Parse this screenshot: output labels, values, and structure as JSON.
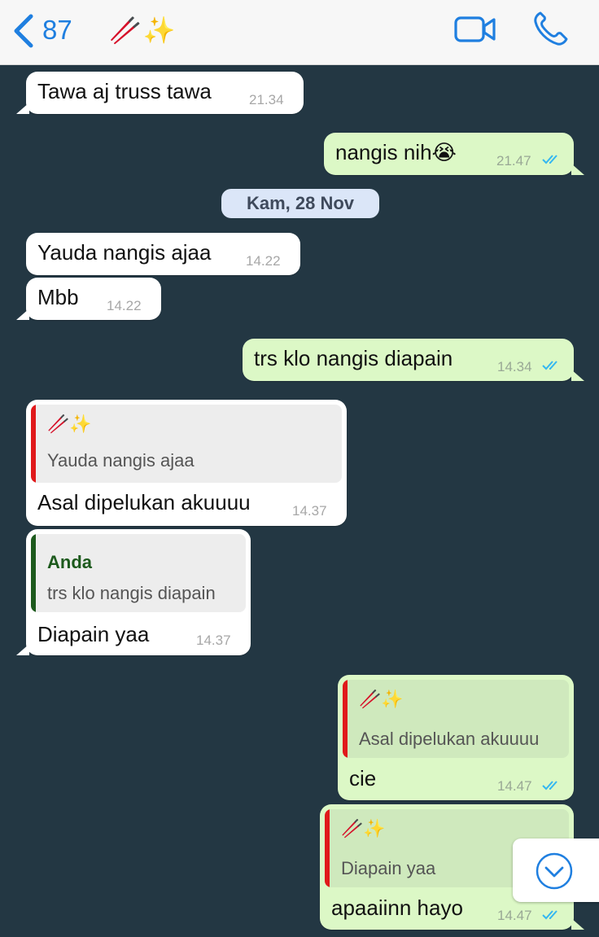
{
  "header": {
    "back_count": "87",
    "contact_name": "🥢✨",
    "icons": [
      "chevron-left-icon",
      "video-call-icon",
      "phone-call-icon"
    ],
    "accent_color": "#1f7fe0"
  },
  "date_separator": "Kam, 28 Nov",
  "messages": [
    {
      "direction": "in",
      "text": "Tawa aj truss tawa",
      "time": "21.34"
    },
    {
      "direction": "out",
      "text": "nangis nih😭",
      "time": "21.47",
      "read": true
    },
    {
      "direction": "in",
      "text": "Yauda nangis ajaa",
      "time": "14.22"
    },
    {
      "direction": "in",
      "text": "Mbb",
      "time": "14.22"
    },
    {
      "direction": "out",
      "text": "trs klo nangis diapain",
      "time": "14.34",
      "read": true
    },
    {
      "direction": "in",
      "text": "Asal dipelukan akuuuu",
      "time": "14.37",
      "quote": {
        "sender": "🥢✨",
        "text": "Yauda nangis ajaa"
      }
    },
    {
      "direction": "in",
      "text": "Diapain yaa",
      "time": "14.37",
      "quote": {
        "sender": "Anda",
        "text": "trs klo nangis diapain"
      }
    },
    {
      "direction": "out",
      "text": "cie",
      "time": "14.47",
      "read": true,
      "quote": {
        "sender": "🥢✨",
        "text": "Asal dipelukan akuuuu"
      }
    },
    {
      "direction": "out",
      "text": "apaaiinn hayo",
      "time": "14.47",
      "read": true,
      "quote": {
        "sender": "🥢✨",
        "text": "Diapain yaa"
      }
    }
  ],
  "colors": {
    "chat_background": "#233743",
    "incoming_bubble": "#ffffff",
    "outgoing_bubble": "#dcf8c6",
    "read_ticks": "#34b7f1",
    "quote_bar_contact": "#e0191b",
    "quote_bar_self": "#1d5a1d"
  },
  "scroll_button_icon": "chevron-down-circle-icon"
}
